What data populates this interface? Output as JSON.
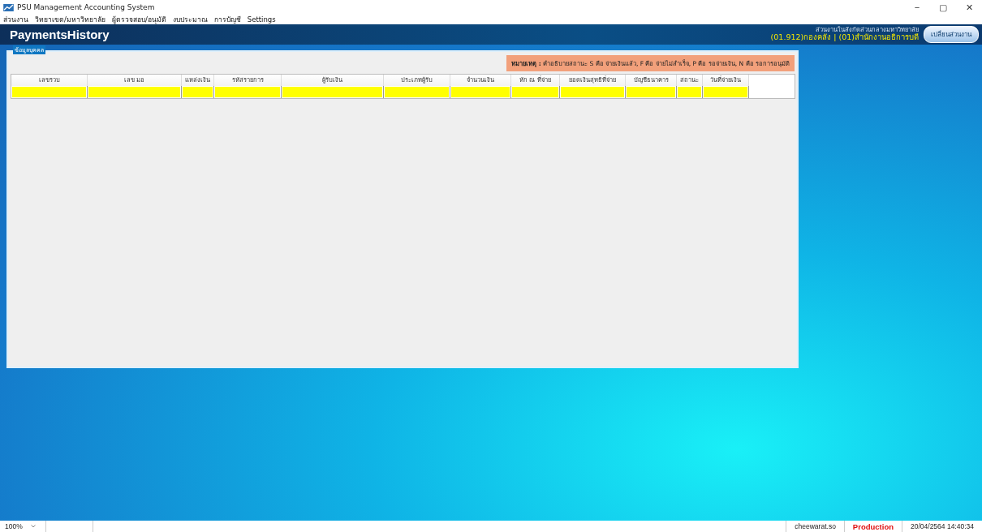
{
  "window": {
    "title": "PSU Management Accounting System",
    "controls": [
      "−",
      "▢",
      "✕"
    ]
  },
  "menu": [
    "ส่วนงาน",
    "วิทยาเขต/มหาวิทยาลัย",
    "ผู้ตรวจสอบ/อนุมัติ",
    "งบประมาณ",
    "การบัญชี",
    "Settings"
  ],
  "header": {
    "title": "PaymentsHistory",
    "org_caption": "ส่วนงานในสังกัดส่วนกลางมหาวิทยาลัย",
    "org_line": "(01.912)กองคลัง  | (01)สำนักงานอธิการบดี",
    "switch_button": "เปลี่ยนส่วนงาน"
  },
  "group": {
    "label": "ข้อมูลบุคคล",
    "note_label": "หมายเหตุ :",
    "note_text": "คำอธิบายสถานะ S คือ จ่ายเงินแล้ว, F คือ จ่ายไม่สำเร็จ, P คือ รอจ่ายเงิน, N คือ รอการอนุมัติ"
  },
  "table": {
    "columns": [
      "เลขรวบ",
      "เลข มอ",
      "แหล่งเงิน",
      "รหัสรายการ",
      "ผู้รับเงิน",
      "ประเภทผู้รับ",
      "จำนวนเงิน",
      "หัก ณ ที่จ่าย",
      "ยอดเงินสุทธิที่จ่าย",
      "บัญชีธนาคาร",
      "สถานะ",
      "วันที่จ่ายเงิน"
    ]
  },
  "status_bar": {
    "zoom": "100%",
    "user": "cheewarat.so",
    "environment": "Production",
    "datetime": "20/04/2564 14:40:34"
  }
}
